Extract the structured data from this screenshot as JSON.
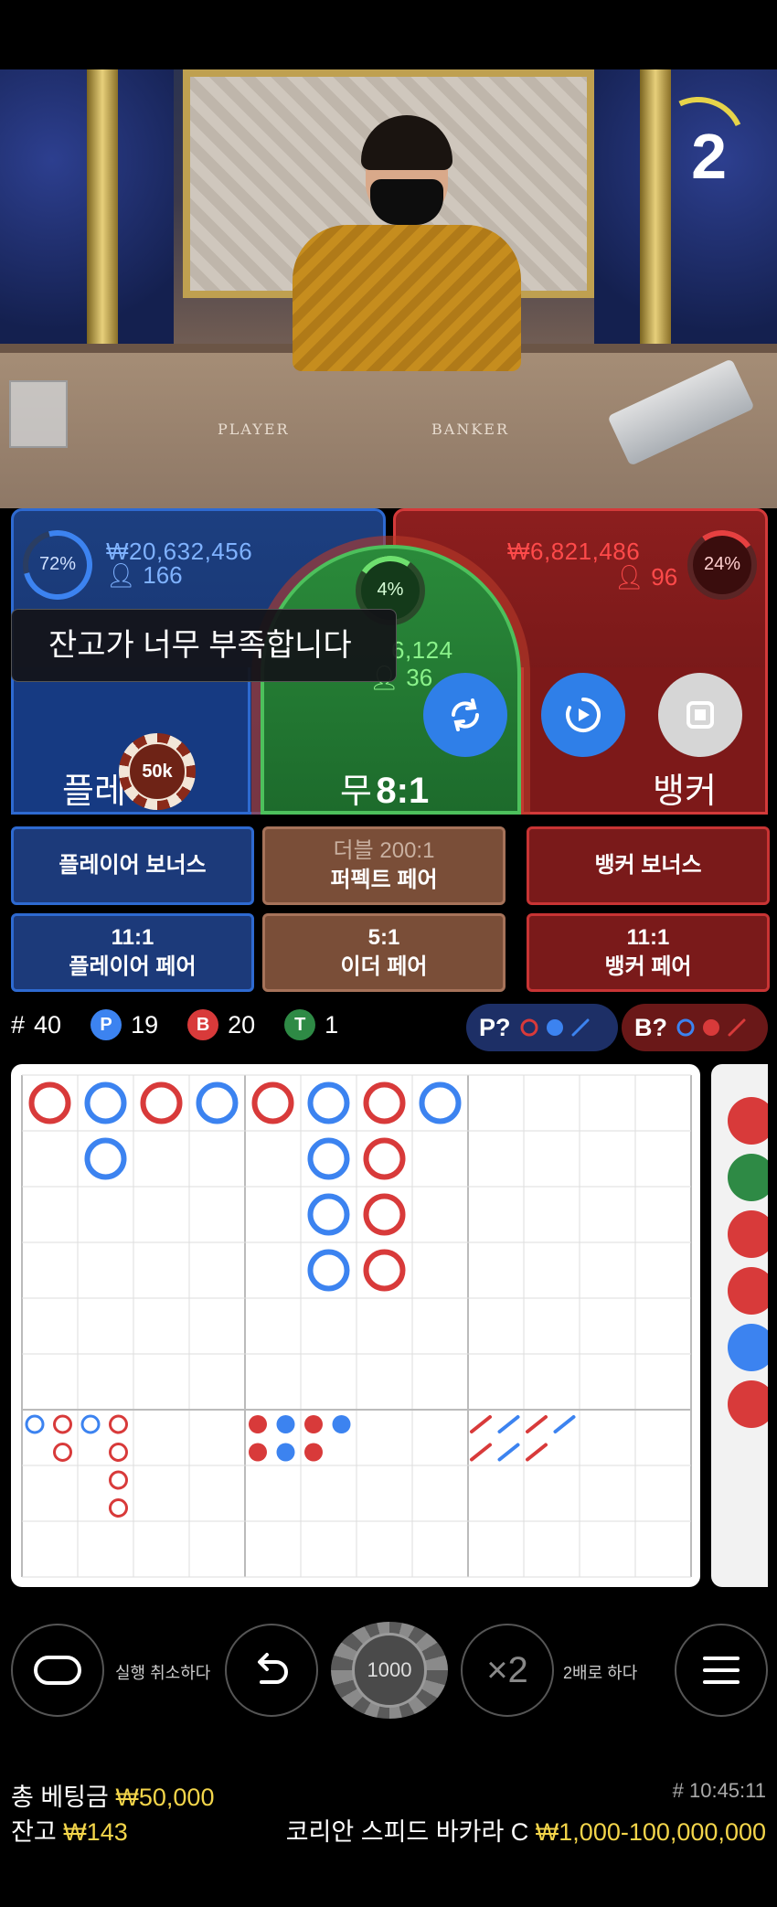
{
  "video": {
    "countdown": "2",
    "table_labels": {
      "player": "PLAYER",
      "banker": "BANKER"
    }
  },
  "player": {
    "percent": "72%",
    "amount": "₩20,632,456",
    "people": "166",
    "label_visible": "플레",
    "label_tail": "",
    "chip_value": "50k"
  },
  "banker": {
    "percent": "24%",
    "amount": "₩6,821,486",
    "people": "96",
    "label": "뱅커"
  },
  "tie": {
    "percent": "4%",
    "amount_partial": "6,124",
    "people_partial": "36",
    "label": "무",
    "payout": "8:1"
  },
  "toast": {
    "message": "잔고가 너무 부족합니다"
  },
  "side_bets": [
    {
      "name": "player-bonus",
      "line1": "플레이어 보너스",
      "line2": ""
    },
    {
      "name": "perfect-pair",
      "line1": "더블 200:1",
      "line2": "퍼펙트 페어"
    },
    {
      "name": "banker-bonus",
      "line1": "뱅커 보너스",
      "line2": ""
    },
    {
      "name": "player-pair",
      "line1": "11:1",
      "line2": "플레이어 페어"
    },
    {
      "name": "either-pair",
      "line1": "5:1",
      "line2": "이더 페어"
    },
    {
      "name": "banker-pair",
      "line1": "11:1",
      "line2": "뱅커 페어"
    }
  ],
  "stats": {
    "rounds_label": "#",
    "rounds": "40",
    "player_letter": "P",
    "player_wins": "19",
    "banker_letter": "B",
    "banker_wins": "20",
    "tie_letter": "T",
    "tie_count": "1",
    "predict_player": "P?",
    "predict_banker": "B?"
  },
  "colors": {
    "player": "#3c83f0",
    "banker": "#d83a3a",
    "tie": "#2e8a45",
    "gold": "#f3d54a"
  },
  "big_road": [
    [
      "B",
      "P",
      "B",
      "P",
      "B",
      "P",
      "B",
      "P"
    ],
    [
      "",
      "P",
      "",
      "",
      "",
      "P",
      "B",
      ""
    ],
    [
      "",
      "",
      "",
      "",
      "",
      "P",
      "B",
      ""
    ],
    [
      "",
      "",
      "",
      "",
      "",
      "P",
      "B",
      ""
    ]
  ],
  "controls": {
    "undo_label": "실행 취소하다",
    "chip_value": "1000",
    "double_symbol": "×2",
    "double_label": "2배로 하다"
  },
  "footer": {
    "total_bet_label": "총 베팅금",
    "total_bet": "₩50,000",
    "balance_label": "잔고",
    "balance": "₩143",
    "game_id": "# 10:45:11",
    "table_name": "코리안 스피드 바카라 C",
    "limits": "₩1,000-100,000,000"
  }
}
